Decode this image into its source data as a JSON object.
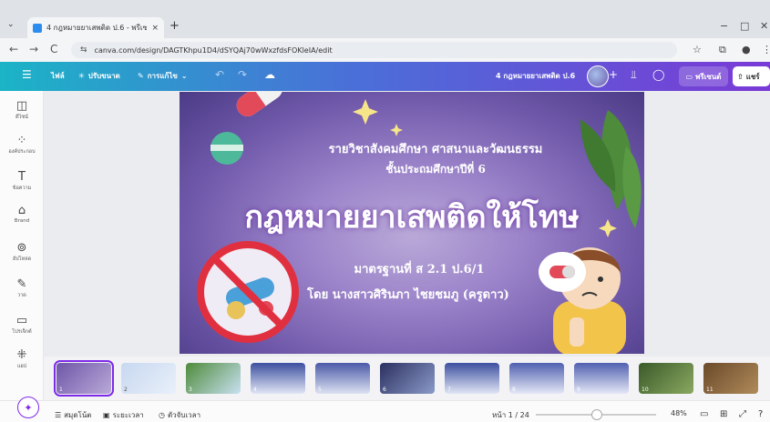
{
  "browser": {
    "tab_title": "4 กฎหมายยาเสพติด ป.6 - พรีเซนเ",
    "tab_close": "×",
    "new_tab": "+",
    "url": "canva.com/design/DAGTKhpu1D4/dSYQAj70wWxzfdsFOKleIA/edit",
    "nav_back": "←",
    "nav_forward": "→",
    "nav_reload": "C",
    "minimize": "−",
    "restore": "□",
    "close": "✕"
  },
  "toolbar": {
    "menu_icon": "☰",
    "file_label": "ไฟล์",
    "resize_label": "ปรับขนาด",
    "edit_label": "การแก้ไข",
    "doc_title": "4 กฎหมายยาเสพติด ป.6",
    "add_label": "+",
    "present_label": "พรีเซนต์",
    "share_label": "แชร์"
  },
  "sidebar": {
    "items": [
      {
        "label": "ดีไซน์",
        "icon": "design-icon"
      },
      {
        "label": "องค์ประกอบ",
        "icon": "elements-icon"
      },
      {
        "label": "ข้อความ",
        "icon": "text-icon"
      },
      {
        "label": "Brand",
        "icon": "brand-icon"
      },
      {
        "label": "อัปโหลด",
        "icon": "upload-icon"
      },
      {
        "label": "วาด",
        "icon": "draw-icon"
      },
      {
        "label": "โปรเจ็กต์",
        "icon": "projects-icon"
      },
      {
        "label": "แอป",
        "icon": "apps-icon"
      }
    ]
  },
  "slide": {
    "line1": "รายวิชาสังคมศึกษา ศาสนาและวัฒนธรรม",
    "line2": "ชั้นประถมศึกษาปีที่ 6",
    "title": "กฎหมายยาเสพติดให้โทษ",
    "standard": "มาตรฐานที่ ส 2.1 ป.6/1",
    "author": "โดย นางสาวศิรินภา ไชยชมภู (ครูดาว)"
  },
  "thumbnails": [
    {
      "num": "1",
      "selected": true
    },
    {
      "num": "2",
      "selected": false
    },
    {
      "num": "3",
      "selected": false
    },
    {
      "num": "4",
      "selected": false
    },
    {
      "num": "5",
      "selected": false
    },
    {
      "num": "6",
      "selected": false
    },
    {
      "num": "7",
      "selected": false
    },
    {
      "num": "8",
      "selected": false
    },
    {
      "num": "9",
      "selected": false
    },
    {
      "num": "10",
      "selected": false
    },
    {
      "num": "11",
      "selected": false
    }
  ],
  "bottom": {
    "notes_label": "สมุดโน้ต",
    "duration_label": "ระยะเวลา",
    "timer_label": "ตัวจับเวลา",
    "page_label": "หน้า 1 / 24",
    "zoom_label": "48%",
    "zoom_fraction": 0.48
  },
  "colors": {
    "toolbar_start": "#1bb4c6",
    "toolbar_end": "#7a3ad6",
    "accent": "#7d2ae8"
  }
}
